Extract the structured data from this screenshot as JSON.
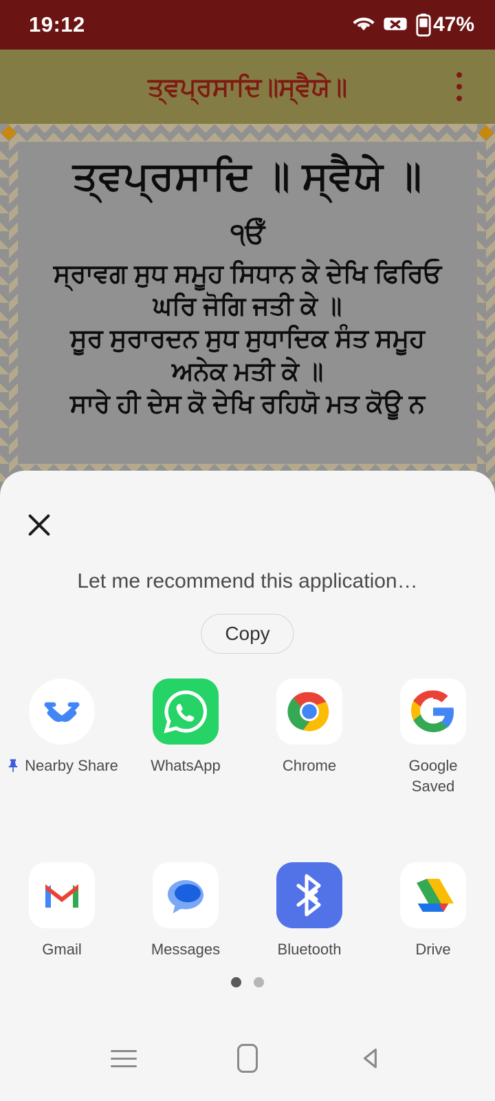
{
  "status_bar": {
    "time": "19:12",
    "battery_percent": "47%",
    "wifi_icon": "wifi-icon",
    "sim_icon": "no-sim-icon",
    "battery_icon": "battery-icon",
    "background_color": "#6B1414",
    "foreground_color": "#FFFFFF"
  },
  "app_bar": {
    "title": "ਤ੍ਵਪ੍ਰਸਾਦਿ॥ਸ੍ਵੈਯੇ॥",
    "overflow_icon": "more-vertical-icon",
    "background_color": "#847C45",
    "title_color": "#7E1A12"
  },
  "document": {
    "heading": "ਤ੍ਵਪ੍ਰਸਾਦਿ ॥ ਸ੍ਵੈਯੇ ॥",
    "ikonkar": "੧ਓਁ",
    "verses": [
      "ਸ੍ਰਾਵਗ ਸੁਧ ਸਮੂਹ ਸਿਧਾਨ ਕੇ ਦੇਖਿ ਫਿਰਿਓ",
      "ਘਰਿ ਜੋਗਿ ਜਤੀ ਕੇ ॥",
      "ਸੂਰ ਸੁਰਾਰਦਨ ਸੁਧ ਸੁਧਾਦਿਕ ਸੰਤ ਸਮੂਹ",
      "ਅਨੇਕ ਮਤੀ ਕੇ ॥",
      "ਸਾਰੇ ਹੀ ਦੇਸ ਕੋ ਦੇਖਿ ਰਹਿਯੋ ਮਤ ਕੋਊ ਨ"
    ],
    "background_color": "#919191",
    "border_color": "#B4A98C",
    "corner_color": "#C8870F"
  },
  "share_sheet": {
    "close_icon": "close-icon",
    "subject_text": "Let me recommend this application…",
    "copy_label": "Copy",
    "background_color": "#F5F5F5",
    "apps_page_1": [
      {
        "label": "Nearby Share",
        "icon": "nearby-share-icon",
        "pinned": true
      },
      {
        "label": "WhatsApp",
        "icon": "whatsapp-icon",
        "pinned": false
      },
      {
        "label": "Chrome",
        "icon": "chrome-icon",
        "pinned": false
      },
      {
        "label": "Google\nSaved",
        "icon": "google-icon",
        "pinned": false
      },
      {
        "label": "Gmail",
        "icon": "gmail-icon",
        "pinned": false
      },
      {
        "label": "Messages",
        "icon": "messages-icon",
        "pinned": false
      },
      {
        "label": "Bluetooth",
        "icon": "bluetooth-icon",
        "pinned": false
      },
      {
        "label": "Drive",
        "icon": "drive-icon",
        "pinned": false
      }
    ],
    "page_indicator": {
      "total": 2,
      "active": 1
    }
  },
  "nav_bar": {
    "recents_icon": "recents-icon",
    "home_icon": "home-icon",
    "back_icon": "back-icon",
    "background_color": "#F5F5F5",
    "icon_color": "#8A8A8A"
  }
}
